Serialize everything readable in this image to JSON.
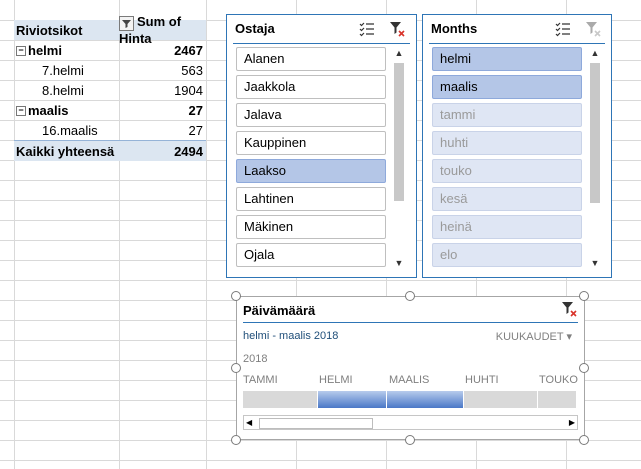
{
  "pivot": {
    "row_header": "Riviotsikot",
    "value_header": "Sum of Hinta",
    "rows": [
      {
        "label": "helmi",
        "value": "2467",
        "level": 0,
        "collapsible": true
      },
      {
        "label": "7.helmi",
        "value": "563",
        "level": 1
      },
      {
        "label": "8.helmi",
        "value": "1904",
        "level": 1
      },
      {
        "label": "maalis",
        "value": "27",
        "level": 0,
        "collapsible": true
      },
      {
        "label": "16.maalis",
        "value": "27",
        "level": 1
      }
    ],
    "total_label": "Kaikki yhteensä",
    "total_value": "2494"
  },
  "slicer_ostaja": {
    "title": "Ostaja",
    "items": [
      {
        "label": "Alanen",
        "state": "normal"
      },
      {
        "label": "Jaakkola",
        "state": "normal"
      },
      {
        "label": "Jalava",
        "state": "normal"
      },
      {
        "label": "Kauppinen",
        "state": "normal"
      },
      {
        "label": "Laakso",
        "state": "selected"
      },
      {
        "label": "Lahtinen",
        "state": "normal"
      },
      {
        "label": "Mäkinen",
        "state": "normal"
      },
      {
        "label": "Ojala",
        "state": "normal"
      }
    ]
  },
  "slicer_months": {
    "title": "Months",
    "items": [
      {
        "label": "helmi",
        "state": "selected"
      },
      {
        "label": "maalis",
        "state": "selected"
      },
      {
        "label": "tammi",
        "state": "dim"
      },
      {
        "label": "huhti",
        "state": "dim"
      },
      {
        "label": "touko",
        "state": "dim"
      },
      {
        "label": "kesä",
        "state": "dim"
      },
      {
        "label": "heinä",
        "state": "dim"
      },
      {
        "label": "elo",
        "state": "dim"
      }
    ]
  },
  "timeline": {
    "title": "Päivämäärä",
    "range_label": "helmi - maalis 2018",
    "unit_label": "KUUKAUDET",
    "year": "2018",
    "months": [
      "TAMMI",
      "HELMI",
      "MAALIS",
      "HUHTI",
      "TOUKO"
    ],
    "selected": [
      "HELMI",
      "MAALIS"
    ]
  },
  "colors": {
    "accent": "#2e75b6",
    "selected_item": "#b4c6e7",
    "dim_item": "#dfe6f4",
    "pivot_header": "#dce6f1"
  },
  "icons": [
    "filter-dropdown-icon",
    "collapse-icon",
    "multi-select-icon",
    "clear-filter-icon",
    "scroll-up-icon",
    "scroll-down-icon",
    "dropdown-arrow-icon",
    "scroll-left-icon",
    "scroll-right-icon"
  ]
}
